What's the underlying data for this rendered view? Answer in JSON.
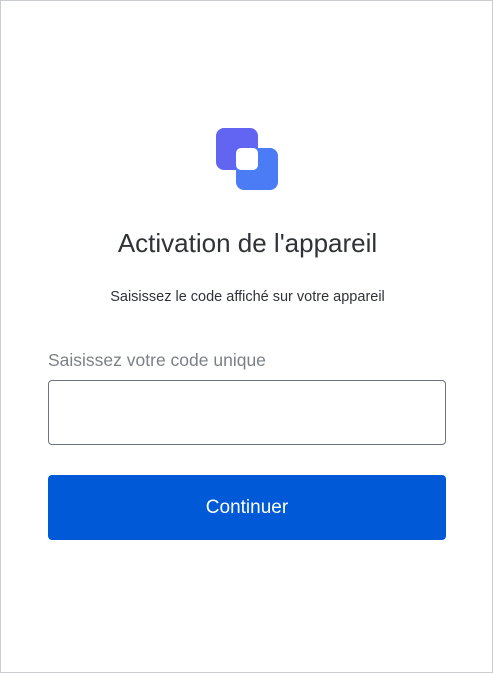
{
  "page": {
    "title": "Activation de l'appareil",
    "subtitle": "Saisissez le code affiché sur votre appareil"
  },
  "form": {
    "code_label": "Saisissez votre code unique",
    "code_value": "",
    "code_placeholder": "",
    "submit_label": "Continuer"
  },
  "icons": {
    "logo": "app-logo-icon"
  },
  "colors": {
    "logo_back": "#6264f2",
    "logo_front": "#4b7cf6",
    "logo_center": "#ffffff",
    "button_background": "#005ad8",
    "button_text": "#ffffff"
  }
}
